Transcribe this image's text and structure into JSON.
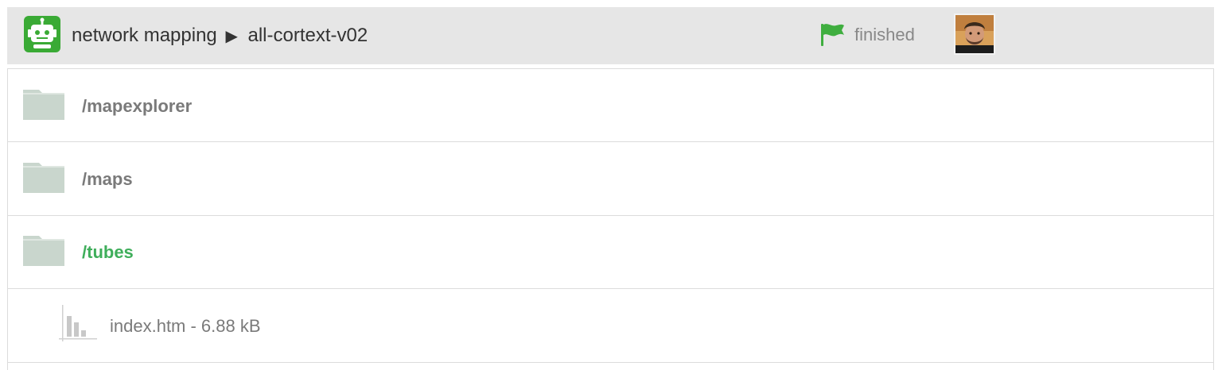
{
  "header": {
    "app_icon": "robot-icon",
    "breadcrumb": {
      "project": "network mapping",
      "separator": "▶",
      "dataset": "all-cortext-v02"
    },
    "status": {
      "icon": "flag-icon",
      "text": "finished",
      "color": "#3fae3f"
    },
    "avatar": "user-avatar"
  },
  "items": [
    {
      "type": "folder",
      "name": "/mapexplorer",
      "icon": "folder-icon"
    },
    {
      "type": "folder",
      "name": "/maps",
      "icon": "folder-icon"
    },
    {
      "type": "folder",
      "name": "/tubes",
      "icon": "folder-icon",
      "active": true
    },
    {
      "type": "file",
      "name": "index.htm - 6.88 kB",
      "icon": "bar-chart-icon"
    }
  ],
  "colors": {
    "header_bg": "#e6e6e6",
    "accent_green": "#3fae5b",
    "folder": "#c9d6cd",
    "text_grey": "#7a7a7a"
  }
}
